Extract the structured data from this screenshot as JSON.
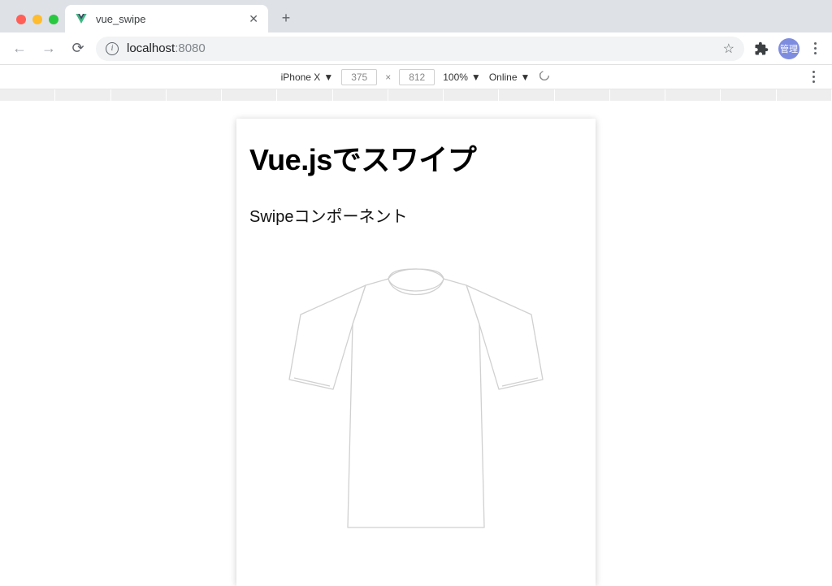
{
  "browser": {
    "tab": {
      "title": "vue_swipe",
      "favicon": "vue"
    },
    "url": {
      "host": "localhost",
      "port": ":8080"
    },
    "profile_label": "管理"
  },
  "devtools": {
    "device": "iPhone X",
    "width": "375",
    "height": "812",
    "separator": "×",
    "zoom": "100%",
    "network": "Online"
  },
  "page": {
    "heading": "Vue.jsでスワイプ",
    "subheading": "Swipeコンポーネント"
  }
}
